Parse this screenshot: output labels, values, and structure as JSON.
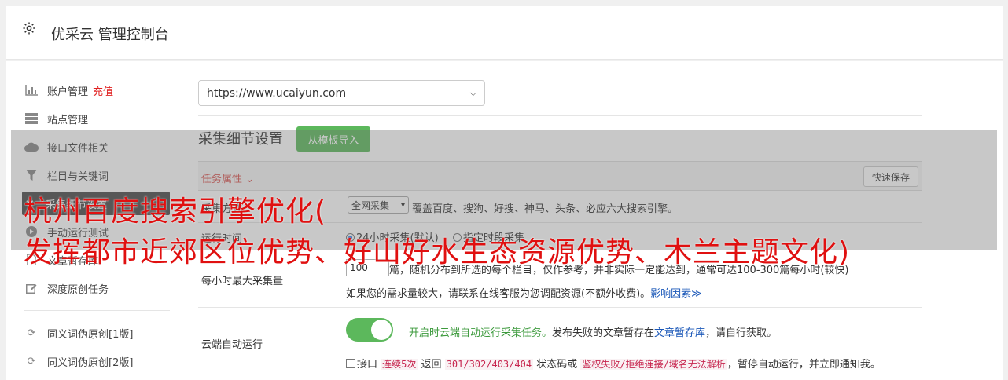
{
  "header": {
    "title": "优采云 管理控制台",
    "icon": "gear-icon"
  },
  "sidebar": {
    "items": [
      {
        "label": "账户管理",
        "accent": "充值",
        "icon": "bar-chart-icon"
      },
      {
        "label": "站点管理",
        "icon": "server-icon"
      },
      {
        "label": "接口文件相关",
        "icon": "cloud-upload-icon"
      },
      {
        "label": "栏目与关键词",
        "icon": "filter-icon"
      },
      {
        "label": "采集细节设置",
        "icon": "wrench-icon",
        "active": true
      },
      {
        "label": "手动运行测试",
        "icon": "play-circle-icon"
      },
      {
        "label": "文章暂存库",
        "icon": "file-icon"
      },
      {
        "label": "深度原创任务",
        "icon": "edit-icon"
      },
      {
        "label": "同义词伪原创[1版]",
        "icon": "refresh-icon"
      },
      {
        "label": "同义词伪原创[2版]",
        "icon": "refresh-icon"
      }
    ]
  },
  "main": {
    "site_select_value": "https://www.ucaiyun.com",
    "section_title": "采集细节设置",
    "template_button": "从模板导入",
    "task_attr_label": "任务属性",
    "quick_save": "快速保存",
    "rows": {
      "collect_mode_label": "采集方式",
      "collect_mode_value": "全网采集",
      "collect_mode_desc": "覆盖百度、搜狗、好搜、神马、头条、必应六大搜索引擎。",
      "run_time_label": "运行时间",
      "run_time_opt1": "24小时采集(默认)",
      "run_time_opt2": "指定时段采集",
      "max_label": "每小时最大采集量",
      "max_value": "100",
      "max_desc": "篇，随机分布到所选的每个栏目，仅作参考，并非实际一定能达到，通常可达100-300篇每小时(较快)",
      "max_desc2": "如果您的需求量较大，请联系在线客服为您调配资源(不额外收费)。",
      "max_link": "影响因素",
      "cloud_label": "云端自动运行",
      "cloud_desc_green": "开启时云端自动运行采集任务。",
      "cloud_desc": "发布失败的文章暂存在",
      "cloud_link": "文章暂存库",
      "cloud_desc_end": "，请自行获取。",
      "iface_prefix": "接口",
      "iface_code1": "连续5次",
      "iface_mid1": "返回",
      "iface_code2": "301/302/403/404",
      "iface_mid2": "状态码或",
      "iface_code3": "鉴权失败/拒绝连接/域名无法解析",
      "iface_end": "，暂停自动运行，并立即通知我。"
    }
  },
  "overlay_text": {
    "line1": "杭州百度搜索引擎优化(",
    "line2": "发挥都市近郊区位优势、好山好水生态资源优势、木兰主题文化)"
  },
  "colors": {
    "accent_red": "#e02020",
    "green": "#5cb85c",
    "link": "#1a57b8"
  }
}
